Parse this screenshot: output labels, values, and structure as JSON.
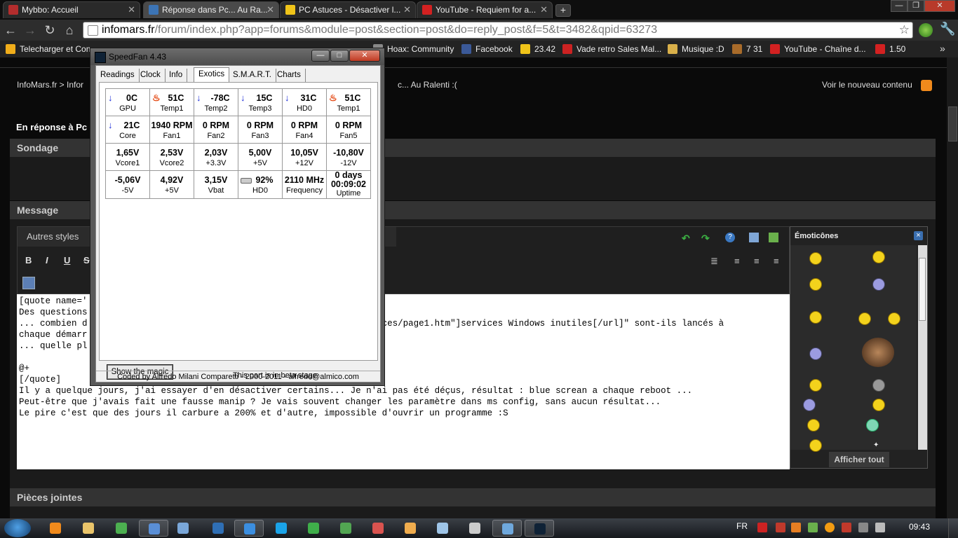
{
  "browser": {
    "tabs": [
      {
        "title": "Mybbo: Accueil",
        "active": false,
        "color": "#b32d2d"
      },
      {
        "title": "Réponse dans Pc... Au Ra...",
        "active": true,
        "color": "#3c74b5"
      },
      {
        "title": "PC Astuces - Désactiver l...",
        "active": false,
        "color": "#f0c419"
      },
      {
        "title": "YouTube - Requiem for a...",
        "active": false,
        "color": "#d32121"
      }
    ],
    "new_tab": "+",
    "window_controls": [
      "—",
      "❐",
      "✕"
    ],
    "url_host": "infomars.fr",
    "url_path": "/forum/index.php?app=forums&module=post&section=post&do=reply_post&f=5&t=3482&qpid=63273",
    "bookmarks": [
      {
        "label": "Telecharger et Con",
        "color": "#f0ad1a"
      },
      {
        "label": "Hoax: Community",
        "color": "#888888"
      },
      {
        "label": "Facebook",
        "color": "#3b5998"
      },
      {
        "label": "23.42",
        "color": "#f0c419"
      },
      {
        "label": "Vade retro Sales Mal...",
        "color": "#cc2222"
      },
      {
        "label": "Musique :D",
        "color": "#d9b04a"
      },
      {
        "label": "7 31",
        "color": "#a86b2a"
      },
      {
        "label": "YouTube - Chaîne d...",
        "color": "#d32121"
      },
      {
        "label": "1.50",
        "color": "#d32121"
      }
    ],
    "more": "»"
  },
  "forum": {
    "breadcrumb": "InfoMars.fr  >  Infor",
    "breadcrumb_tail": "c... Au Ralenti :(",
    "view_new": "Voir le nouveau contenu",
    "reply_title": "En réponse à Pc",
    "section_sondage": "Sondage",
    "section_message": "Message",
    "section_attachments": "Pièces jointes",
    "styles_dropdown": "Autres styles",
    "format_bold": "B",
    "format_italic": "I",
    "format_underline": "U",
    "format_strike": "S",
    "editor_lines": [
      "[quote name='",
      "Des questions",
      "... combien d                                                    ervices/page1.htm\"]services Windows inutiles[/url]\" sont-ils lancés à",
      "chaque démarr",
      "... quelle pl",
      "",
      "@+",
      "[/quote]",
      "Il y a quelque jours, j'ai essayer d'en désactiver certains... Je n'ai pas été déçus, résultat : blue screan a chaque reboot ...",
      "Peut-être que j'avais fait une fausse manip ? Je vais souvent changer les paramètre dans ms config, sans aucun résultat...",
      "Le pire c'est que des jours il carbure a 200% et d'autre, impossible d'ouvrir un programme :S"
    ],
    "emoticons_title": "Émoticônes",
    "emoticons_close": "×",
    "show_all": "Afficher tout"
  },
  "speedfan": {
    "title": "SpeedFan 4.43",
    "controls": [
      "—",
      "□",
      "✕"
    ],
    "tabs": [
      "Readings",
      "Clock",
      "Info",
      "Exotics",
      "S.M.A.R.T.",
      "Charts"
    ],
    "active_tab": "Exotics",
    "rows": [
      [
        {
          "value": "0C",
          "label": "GPU",
          "indicator": "down"
        },
        {
          "value": "51C",
          "label": "Temp1",
          "indicator": "hot"
        },
        {
          "value": "-78C",
          "label": "Temp2",
          "indicator": "down"
        },
        {
          "value": "15C",
          "label": "Temp3",
          "indicator": "down"
        },
        {
          "value": "31C",
          "label": "HD0",
          "indicator": "down"
        },
        {
          "value": "51C",
          "label": "Temp1",
          "indicator": "hot"
        }
      ],
      [
        {
          "value": "21C",
          "label": "Core",
          "indicator": "down"
        },
        {
          "value": "1940 RPM",
          "label": "Fan1",
          "indicator": ""
        },
        {
          "value": "0 RPM",
          "label": "Fan2",
          "indicator": ""
        },
        {
          "value": "0 RPM",
          "label": "Fan3",
          "indicator": ""
        },
        {
          "value": "0 RPM",
          "label": "Fan4",
          "indicator": ""
        },
        {
          "value": "0 RPM",
          "label": "Fan5",
          "indicator": ""
        }
      ],
      [
        {
          "value": "1,65V",
          "label": "Vcore1",
          "indicator": ""
        },
        {
          "value": "2,53V",
          "label": "Vcore2",
          "indicator": ""
        },
        {
          "value": "2,03V",
          "label": "+3.3V",
          "indicator": ""
        },
        {
          "value": "5,00V",
          "label": "+5V",
          "indicator": ""
        },
        {
          "value": "10,05V",
          "label": "+12V",
          "indicator": ""
        },
        {
          "value": "-10,80V",
          "label": "-12V",
          "indicator": ""
        }
      ],
      [
        {
          "value": "-5,06V",
          "label": "-5V",
          "indicator": ""
        },
        {
          "value": "4,92V",
          "label": "+5V",
          "indicator": ""
        },
        {
          "value": "3,15V",
          "label": "Vbat",
          "indicator": ""
        },
        {
          "value": "92%",
          "label": "HD0",
          "indicator": "hdd"
        },
        {
          "value": "2110 MHz",
          "label": "Frequency",
          "indicator": ""
        },
        {
          "value": "0 days",
          "value2": "00:09:02",
          "label": "Uptime",
          "indicator": ""
        }
      ]
    ],
    "magic_button": "Show the magic",
    "beta_note": "This part is in beta stage",
    "footer": "Coded by Alfredo Milani Comparetti - 2000-2011 - alfredo@almico.com"
  },
  "taskbar": {
    "language": "FR",
    "time": "09:43",
    "apps": [
      {
        "name": "media-player",
        "color": "#f08a1c"
      },
      {
        "name": "explorer",
        "color": "#e9c46a"
      },
      {
        "name": "task-manager",
        "color": "#4caf50"
      },
      {
        "name": "app-4",
        "color": "#5a8fd6"
      },
      {
        "name": "app-5",
        "color": "#7aa7d9"
      },
      {
        "name": "app-6",
        "color": "#2f6fb5"
      },
      {
        "name": "internet-explorer",
        "color": "#3b8ee0"
      },
      {
        "name": "skype",
        "color": "#1aa3e8"
      },
      {
        "name": "messenger",
        "color": "#3fae4a"
      },
      {
        "name": "app-10",
        "color": "#52a552"
      },
      {
        "name": "app-11",
        "color": "#d9534f"
      },
      {
        "name": "app-12",
        "color": "#f0ad4e"
      },
      {
        "name": "app-13",
        "color": "#9fc5e8"
      },
      {
        "name": "app-14",
        "color": "#cccccc"
      },
      {
        "name": "app-15",
        "color": "#6fa8dc"
      },
      {
        "name": "speedfan",
        "color": "#0f2236"
      }
    ]
  }
}
